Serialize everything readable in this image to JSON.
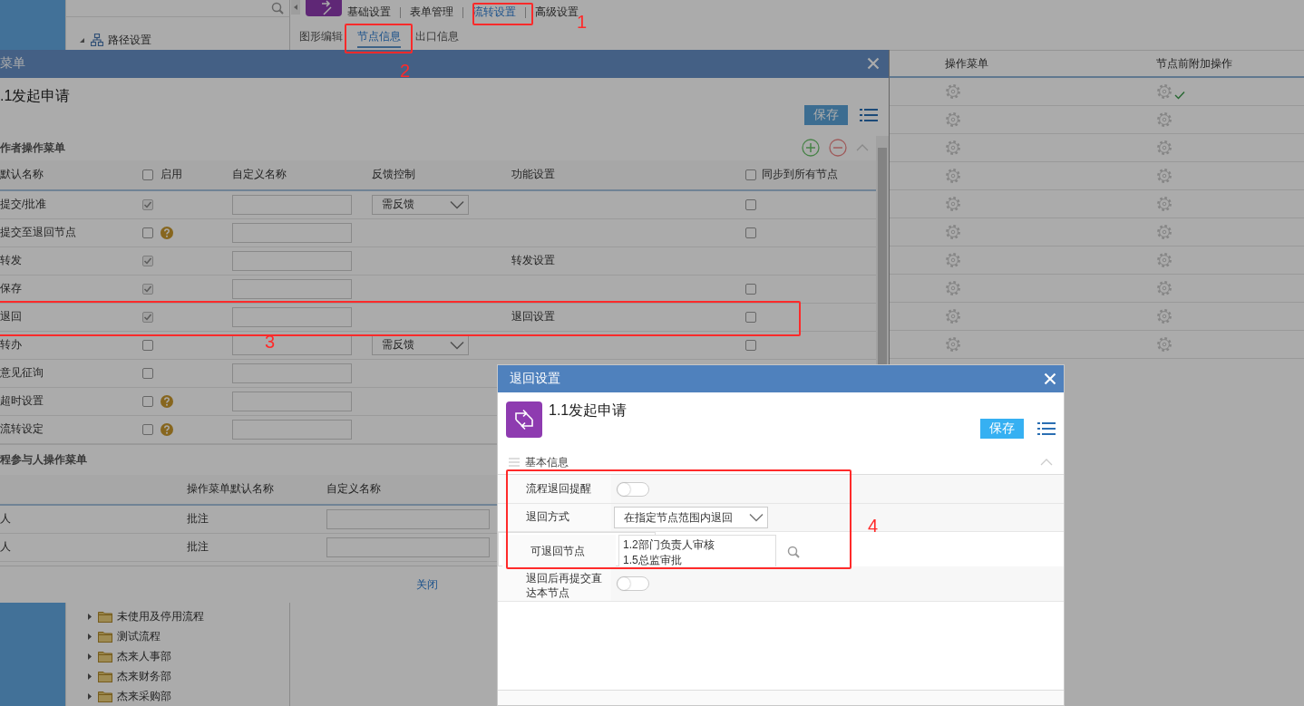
{
  "tree": {
    "label": "路径设置",
    "expanded": true,
    "children": [
      {
        "label": "未使用及停用流程",
        "expanded": false
      },
      {
        "label": "测试流程",
        "expanded": false
      },
      {
        "label": "杰来人事部",
        "expanded": false
      },
      {
        "label": "杰来财务部",
        "expanded": false
      },
      {
        "label": "杰来采购部",
        "expanded": false
      }
    ]
  },
  "nav_tabs": [
    {
      "label": "基础设置",
      "selected": false
    },
    {
      "label": "表单管理",
      "selected": false
    },
    {
      "label": "流转设置",
      "selected": true
    },
    {
      "label": "高级设置",
      "selected": false
    }
  ],
  "sub_tabs": [
    {
      "label": "图形编辑",
      "selected": false
    },
    {
      "label": "节点信息",
      "selected": true
    },
    {
      "label": "出口信息",
      "selected": false
    }
  ],
  "node_table": {
    "columns": [
      "操作菜单",
      "节点前附加操作"
    ],
    "rows": [
      {
        "extra_set": true
      },
      {
        "extra_set": false
      },
      {
        "extra_set": false
      },
      {
        "extra_set": false
      },
      {
        "extra_set": false
      },
      {
        "extra_set": false
      },
      {
        "extra_set": false
      },
      {
        "extra_set": false
      },
      {
        "extra_set": false
      },
      {
        "extra_set": false
      }
    ]
  },
  "menu_dialog": {
    "title": "菜单",
    "node_title": ".1发起申请",
    "save": "保存",
    "handler_section": {
      "title": "作者操作菜单",
      "columns": [
        {
          "label": "默认名称"
        },
        {
          "label": "启用",
          "checked": false
        },
        {
          "label": "自定义名称"
        },
        {
          "label": "反馈控制"
        },
        {
          "label": "功能设置"
        },
        {
          "label": "同步到所有节点",
          "checked": false
        }
      ],
      "rows": [
        {
          "name": "提交/批准",
          "enabled": true,
          "help": false,
          "feedback": "需反馈",
          "sync": false
        },
        {
          "name": "提交至退回节点",
          "enabled": false,
          "help": true,
          "sync": false
        },
        {
          "name": "转发",
          "enabled": true,
          "help": false,
          "function": "转发设置"
        },
        {
          "name": "保存",
          "enabled": true,
          "help": false,
          "sync": false
        },
        {
          "name": "退回",
          "enabled": true,
          "help": false,
          "function": "退回设置",
          "sync": false
        },
        {
          "name": "转办",
          "enabled": false,
          "help": false,
          "feedback": "需反馈",
          "sync": false
        },
        {
          "name": "意见征询",
          "enabled": false,
          "help": false
        },
        {
          "name": "超时设置",
          "enabled": false,
          "help": true
        },
        {
          "name": "流转设定",
          "enabled": false,
          "help": true
        }
      ]
    },
    "participant_section": {
      "title": "程参与人操作菜单",
      "columns": [
        "操作菜单默认名称",
        "自定义名称"
      ],
      "rows": [
        {
          "column_1": "人",
          "default_name": "批注"
        },
        {
          "column_1": "人",
          "default_name": "批注"
        }
      ]
    },
    "close": "关闭"
  },
  "return_dialog": {
    "title": "退回设置",
    "node_title": "1.1发起申请",
    "save": "保存",
    "section": "基本信息",
    "fields": [
      {
        "kind": "toggle",
        "label": "流程退回提醒",
        "on": false
      },
      {
        "kind": "select",
        "label": "退回方式",
        "value": "在指定节点范围内退回"
      },
      {
        "kind": "list",
        "label": "可退回节点",
        "items": [
          "1.2部门负责人审核",
          "1.5总监审批"
        ]
      },
      {
        "kind": "toggle",
        "label": "退回后再提交直达本节点",
        "on": false
      }
    ]
  },
  "annotations": [
    {
      "label": "1"
    },
    {
      "label": "2"
    },
    {
      "label": "3"
    },
    {
      "label": "4"
    }
  ]
}
